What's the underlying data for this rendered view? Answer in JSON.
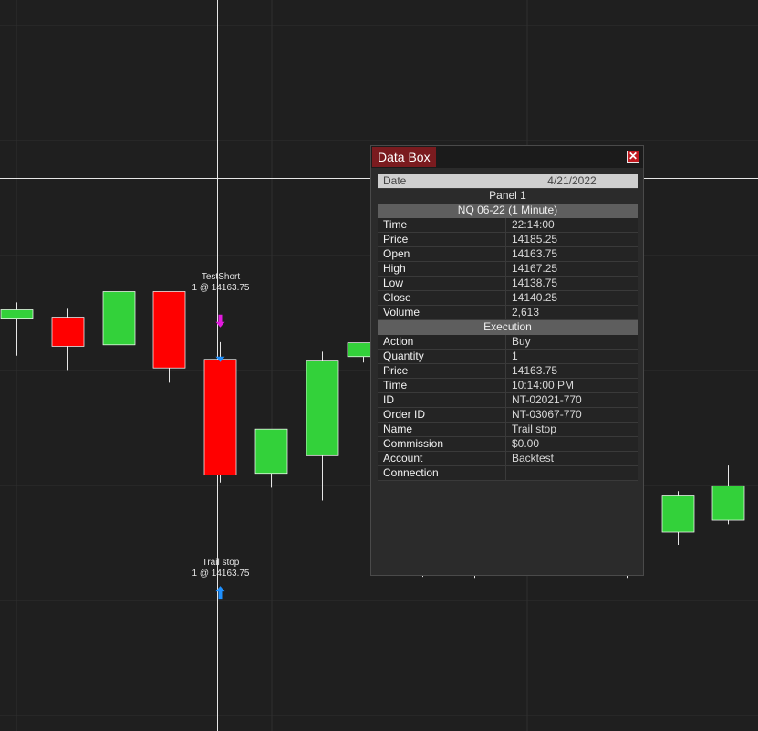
{
  "chart_data": {
    "type": "candlestick",
    "candles": [
      {
        "open": 14172.1,
        "high": 14175.3,
        "low": 14164.5,
        "close": 14173.8
      },
      {
        "open": 14172.3,
        "high": 14174.0,
        "low": 14161.6,
        "close": 14166.4
      },
      {
        "open": 14166.7,
        "high": 14181.0,
        "low": 14160.1,
        "close": 14177.5
      },
      {
        "open": 14177.5,
        "high": 14177.5,
        "low": 14159.0,
        "close": 14162.0
      },
      {
        "open": 14163.75,
        "high": 14167.25,
        "low": 14138.75,
        "close": 14140.25
      },
      {
        "open": 14140.6,
        "high": 14149.6,
        "low": 14137.7,
        "close": 14149.6
      },
      {
        "open": 14144.2,
        "high": 14165.3,
        "low": 14135.1,
        "close": 14163.4
      },
      {
        "open": 14164.3,
        "high": 14167.1,
        "low": 14163.1,
        "close": 14167.1
      },
      {
        "open": 14126.0,
        "high": 14126.0,
        "low": 14119.6,
        "close": 14126.0
      },
      {
        "open": 14123.0,
        "high": 14123.0,
        "low": 14119.4,
        "close": 14123.0
      },
      {
        "open": 14138.0,
        "high": 14138.0,
        "low": 14119.4,
        "close": 14124.8
      },
      {
        "open": 14124.8,
        "high": 14132.5,
        "low": 14119.4,
        "close": 14131.1
      },
      {
        "open": 14128.7,
        "high": 14137.0,
        "low": 14126.1,
        "close": 14136.2
      },
      {
        "open": 14131.1,
        "high": 14142.2,
        "low": 14130.3,
        "close": 14138.1
      }
    ],
    "annotations": [
      {
        "name": "TestShort",
        "detail": "1 @ 14163.75"
      },
      {
        "name": "Trail stop",
        "detail": "1 @ 14163.75"
      }
    ],
    "colors": {
      "up": "#33d13a",
      "down": "#ff0000",
      "wick": "#e6e6e6",
      "grid": "#2f2f2f",
      "crosshair": "#e6e6e6",
      "entry_arrow": "#e21adf",
      "exit_arrow": "#1e90ff"
    }
  },
  "databox": {
    "title": "Data Box",
    "close_icon": "close-icon",
    "date": {
      "label": "Date",
      "value": "4/21/2022"
    },
    "panel": "Panel 1",
    "instrument": "NQ 06-22 (1 Minute)",
    "bar": [
      {
        "label": "Time",
        "value": "22:14:00"
      },
      {
        "label": "Price",
        "value": "14185.25"
      },
      {
        "label": "Open",
        "value": "14163.75"
      },
      {
        "label": "High",
        "value": "14167.25"
      },
      {
        "label": "Low",
        "value": "14138.75"
      },
      {
        "label": "Close",
        "value": "14140.25"
      },
      {
        "label": "Volume",
        "value": "2,613"
      }
    ],
    "execution_header": "Execution",
    "execution": [
      {
        "label": "Action",
        "value": "Buy"
      },
      {
        "label": "Quantity",
        "value": "1"
      },
      {
        "label": "Price",
        "value": "14163.75"
      },
      {
        "label": "Time",
        "value": "10:14:00 PM"
      },
      {
        "label": "ID",
        "value": "NT-02021-770"
      },
      {
        "label": "Order ID",
        "value": "NT-03067-770"
      },
      {
        "label": "Name",
        "value": "Trail stop"
      },
      {
        "label": "Commission",
        "value": "$0.00"
      },
      {
        "label": "Account",
        "value": "Backtest"
      },
      {
        "label": "Connection",
        "value": ""
      }
    ]
  }
}
